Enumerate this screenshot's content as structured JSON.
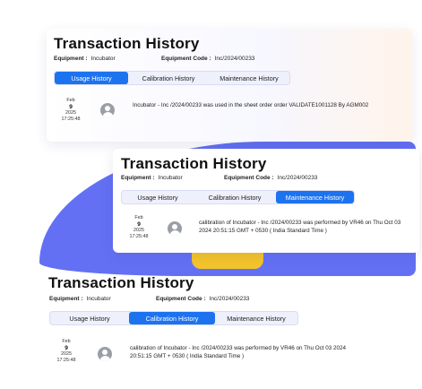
{
  "cards": [
    {
      "title": "Transaction History",
      "equipment_label": "Equipment :",
      "equipment_value": "Incubator",
      "code_label": "Equipment Code :",
      "code_value": "Inc/2024/00233",
      "tabs": [
        "Usage History",
        "Calibration History",
        "Maintenance History"
      ],
      "active_tab": "Usage History",
      "entry": {
        "month": "Feb",
        "day": "9",
        "year": "2025",
        "time": "17:25:48",
        "text": "Incubator - Inc /2024/00233 was used in the sheet order order VALIDATE1001128 By AGM002"
      }
    },
    {
      "title": "Transaction History",
      "equipment_label": "Equipment :",
      "equipment_value": "Incubator",
      "code_label": "Equipment Code :",
      "code_value": "Inc/2024/00233",
      "tabs": [
        "Usage History",
        "Calibration History",
        "Maintenance History"
      ],
      "active_tab": "Maintenance History",
      "entry": {
        "month": "Feb",
        "day": "9",
        "year": "2025",
        "time": "17:25:48",
        "text": "calibration of Incubator - Inc /2024/00233 was performed by VR46 on Thu Oct 03 2024 20:51:15 GMT + 0530 ( India Standard Time )"
      }
    },
    {
      "title": "Transaction History",
      "equipment_label": "Equipment :",
      "equipment_value": "Incubator",
      "code_label": "Equipment Code :",
      "code_value": "Inc/2024/00233",
      "tabs": [
        "Usage History",
        "Calibration History",
        "Maintenance History"
      ],
      "active_tab": "Calibration History",
      "entry": {
        "month": "Feb",
        "day": "9",
        "year": "2025",
        "time": "17:25:48",
        "text": "calibration of Incubator - Inc /2024/00233 was performed by VR46 on Thu Oct 03 2024 20:51:15 GMT + 0530 ( India Standard Time )"
      }
    }
  ],
  "colors": {
    "accent": "#1d73ef",
    "backdrop": "#6470f4",
    "highlight": "#f4c42a",
    "avatar": "#9a9ea6"
  },
  "icons": {
    "avatar": "user-avatar-icon"
  }
}
